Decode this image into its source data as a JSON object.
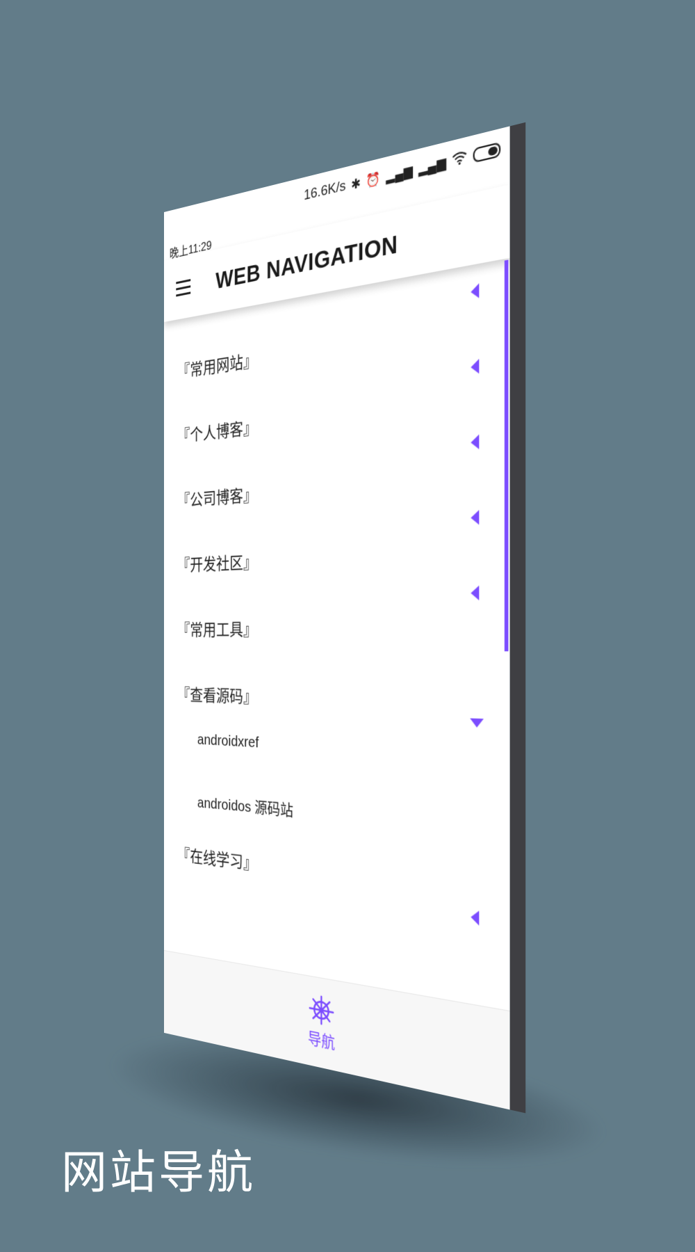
{
  "status_bar": {
    "time": "晚上11:29",
    "speed": "16.6K/s",
    "icons": [
      "bluetooth-icon",
      "alarm-icon",
      "signal-icon",
      "signal-icon",
      "wifi-icon",
      "battery-icon"
    ]
  },
  "app_bar": {
    "menu_icon": "menu-icon",
    "title": "WEB NAVIGATION"
  },
  "list": {
    "categories": [
      {
        "label": "『常用网站』",
        "state": "collapsed"
      },
      {
        "label": "『个人博客』",
        "state": "collapsed"
      },
      {
        "label": "『公司博客』",
        "state": "collapsed"
      },
      {
        "label": "『开发社区』",
        "state": "collapsed"
      },
      {
        "label": "『常用工具』",
        "state": "collapsed"
      },
      {
        "label": "『查看源码』",
        "state": "expanded"
      },
      {
        "label": "『在线学习』",
        "state": "collapsed"
      }
    ],
    "sub_items": [
      {
        "label": "androidxref"
      },
      {
        "label": "androidos 源码站"
      }
    ]
  },
  "bottom_nav": {
    "icon": "ship-wheel-icon",
    "label": "导航"
  },
  "caption": "网站导航",
  "colors": {
    "background": "#627c89",
    "accent": "#7c4dff",
    "device_edge": "#3f3f43"
  }
}
